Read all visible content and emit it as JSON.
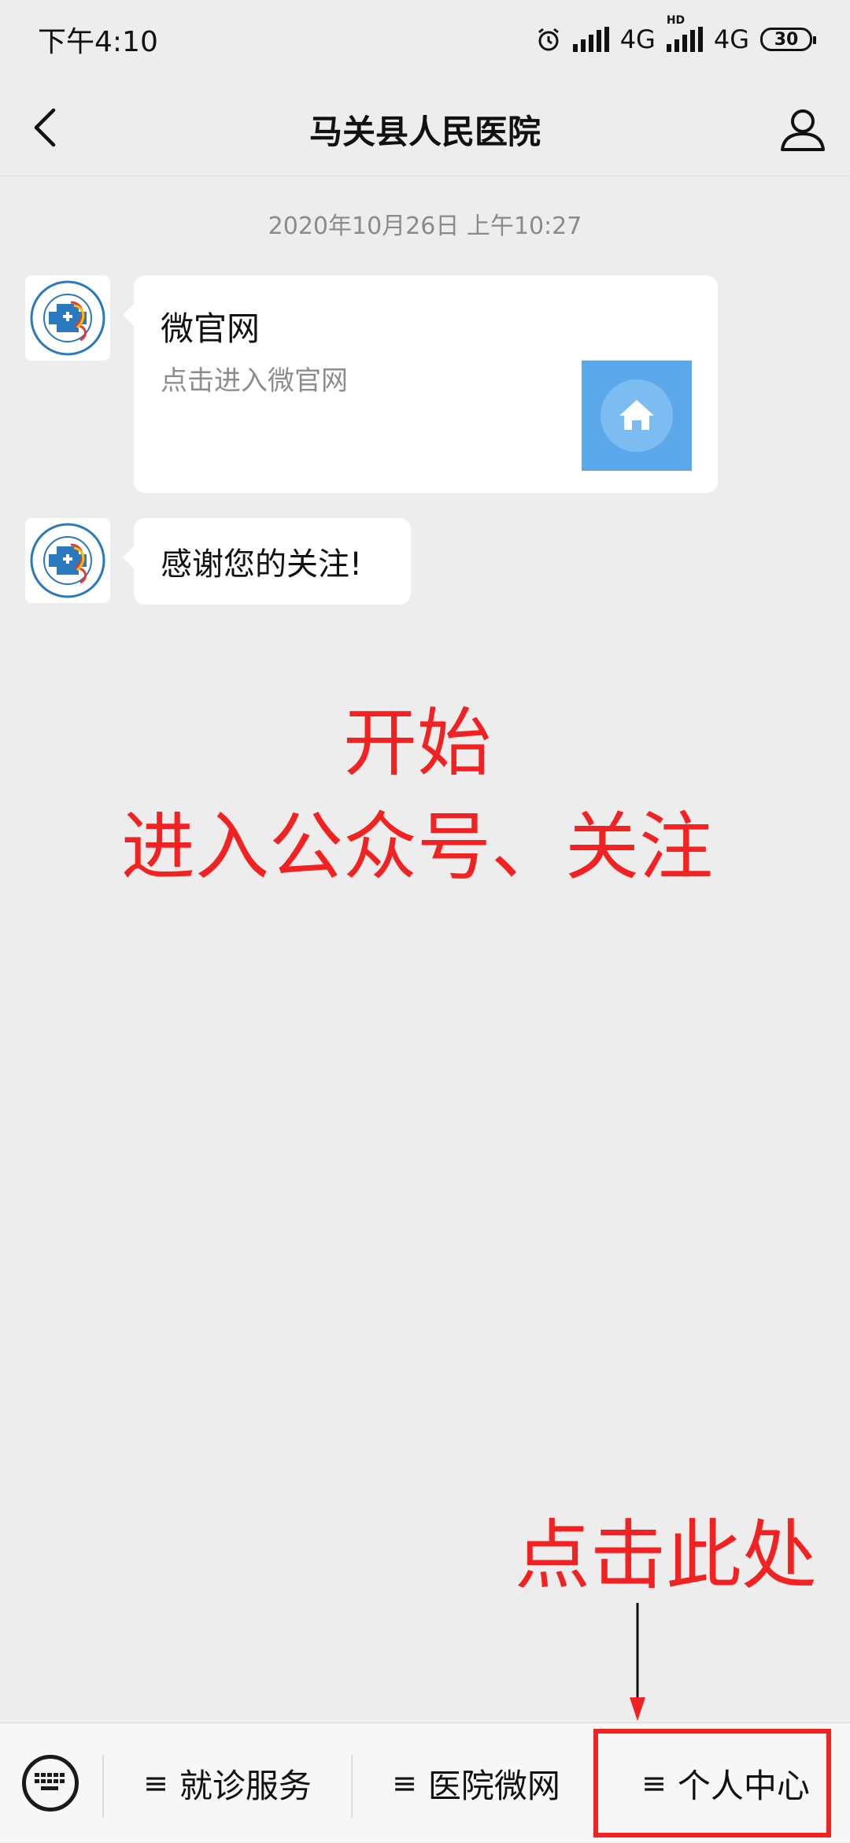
{
  "status_bar": {
    "time": "下午4:10",
    "network_1": "4G",
    "network_2": "4G",
    "hd_label": "HD",
    "battery": "30"
  },
  "nav": {
    "title": "马关县人民医院",
    "back_icon": "chevron-left-icon",
    "profile_icon": "user-icon"
  },
  "chat": {
    "timestamp": "2020年10月26日 上午10:27",
    "messages": [
      {
        "type": "link-card",
        "title": "微官网",
        "description": "点击进入微官网",
        "thumb_icon": "home-icon",
        "thumb_color": "#5ba8ea"
      },
      {
        "type": "text",
        "text": "感谢您的关注!"
      }
    ]
  },
  "annotations": {
    "line_1": "开始",
    "line_2": "进入公众号、关注",
    "tap_here": "点击此处",
    "color": "#f22222"
  },
  "bottom_menu": {
    "keyboard_icon": "keyboard-icon",
    "items": [
      {
        "label": "就诊服务",
        "glyph": "≡"
      },
      {
        "label": "医院微网",
        "glyph": "≡"
      },
      {
        "label": "个人中心",
        "glyph": "≡"
      }
    ]
  }
}
